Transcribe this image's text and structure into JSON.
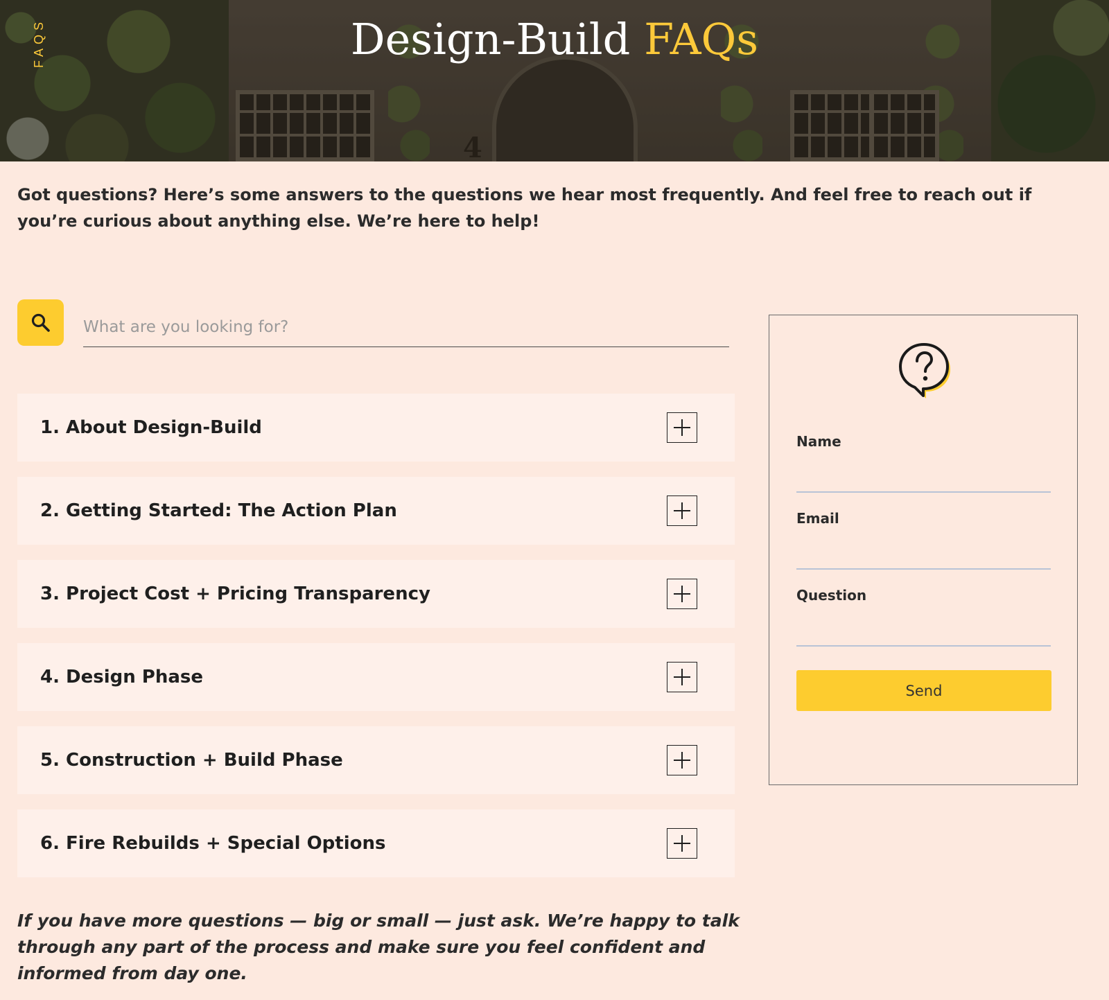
{
  "hero": {
    "side_tag": "FAQS",
    "title_main": "Design-Build",
    "title_accent": "FAQs",
    "house_number": "4"
  },
  "intro": "Got questions? Here’s some answers to the questions we hear most frequently.  And feel free to reach out if you’re curious about anything else. We’re here to help!",
  "search": {
    "placeholder": "What are you looking for?",
    "value": "",
    "icon": "search-icon"
  },
  "faqs": [
    {
      "label": "1. About Design-Build"
    },
    {
      "label": "2. Getting Started: The Action Plan"
    },
    {
      "label": "3. Project Cost + Pricing Transparency"
    },
    {
      "label": "4. Design Phase"
    },
    {
      "label": "5. Construction + Build Phase"
    },
    {
      "label": "6. Fire Rebuilds + Special Options"
    }
  ],
  "closing": "If you have more questions — big or small — just ask. We’re happy to talk through any part of the process and make sure you feel confident and informed from day one.",
  "contact_form": {
    "icon": "question-bubble-icon",
    "name_label": "Name",
    "email_label": "Email",
    "question_label": "Question",
    "send_label": "Send"
  },
  "colors": {
    "accent": "#fdcc2f",
    "background": "#fde9df",
    "faq_item_bg": "#fef0ea",
    "text": "#232323"
  }
}
